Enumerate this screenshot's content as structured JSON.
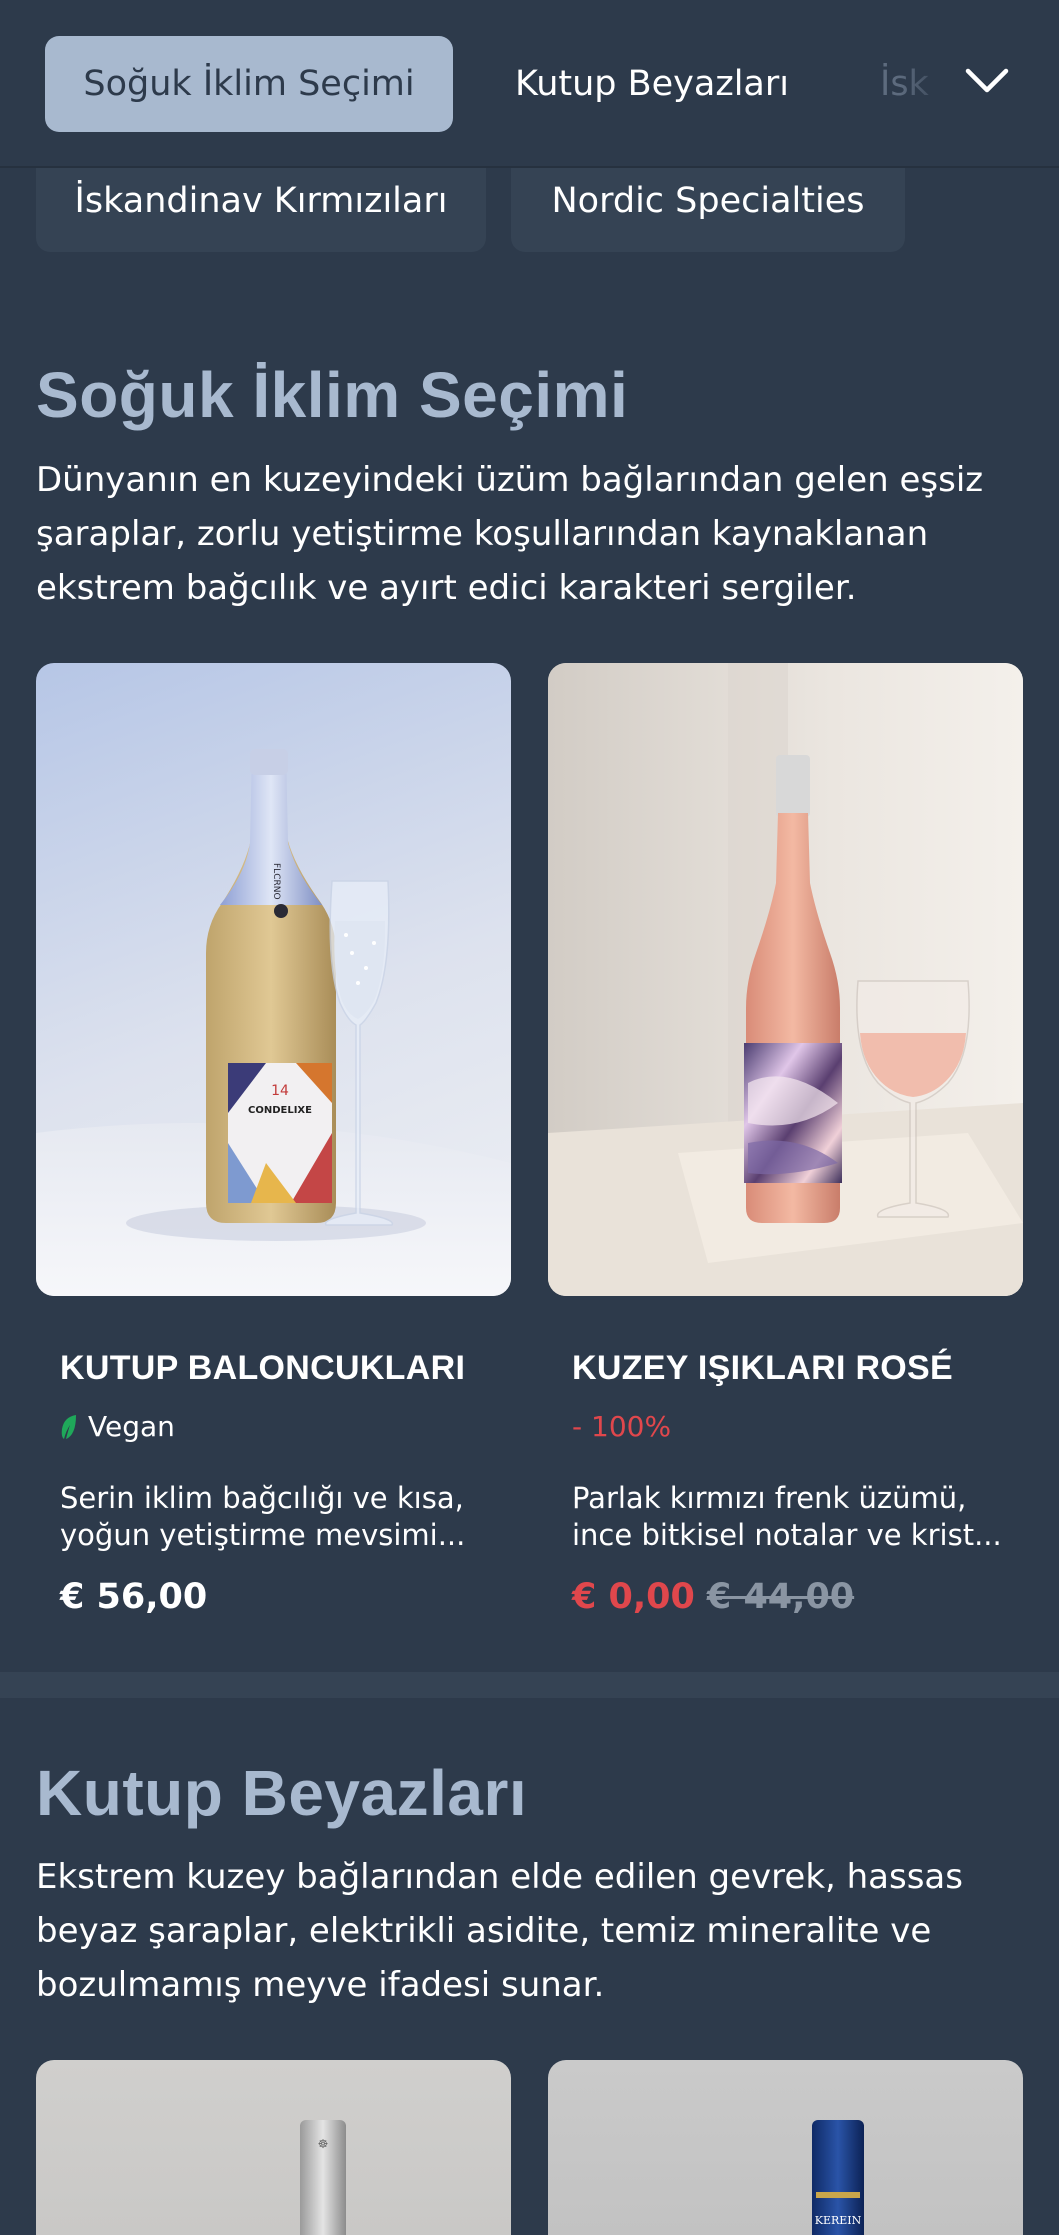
{
  "tabs": {
    "items": [
      "Soğuk İklim Seçimi",
      "Kutup Beyazları",
      "İsk"
    ],
    "row2": [
      "İskandinav Kırmızıları",
      "Nordic Specialties"
    ]
  },
  "sections": [
    {
      "title": "Soğuk İklim Seçimi",
      "description": "Dünyanın en kuzeyindeki üzüm bağlarından gelen eşsiz şaraplar, zorlu yetiştirme koşullarından kaynaklanan ekstrem bağcılık ve ayırt edici karakteri sergiler.",
      "products": [
        {
          "name": "KUTUP BALONCUKLARI",
          "badge": "Vegan",
          "badge_icon": "leaf-icon",
          "description": "Serin iklim bağcılığı ve kısa, yoğun yetiştirme mevsimi...",
          "price": "€ 56,00"
        },
        {
          "name": "KUZEY IŞIKLARI ROSÉ",
          "badge": "- 100%",
          "description": "Parlak kırmızı frenk üzümü, ince bitkisel notalar ve krist...",
          "price": "€ 0,00",
          "old_price": "€ 44,00"
        }
      ]
    },
    {
      "title": "Kutup Beyazları",
      "description": "Ekstrem kuzey bağlarından elde edilen gevrek, hassas beyaz şaraplar, elektrikli asidite, temiz mineralite ve bozulmamış meyve ifadesi sunar."
    }
  ],
  "bottle_label": {
    "brand": "FLCRNO",
    "number": "14",
    "name": "CONDELIXE",
    "label_4": "KEREIN"
  },
  "colors": {
    "background": "#2d3a4b",
    "accent": "#a8b9cf",
    "sale": "#e0474c",
    "vegan_leaf": "#1fa85a"
  }
}
